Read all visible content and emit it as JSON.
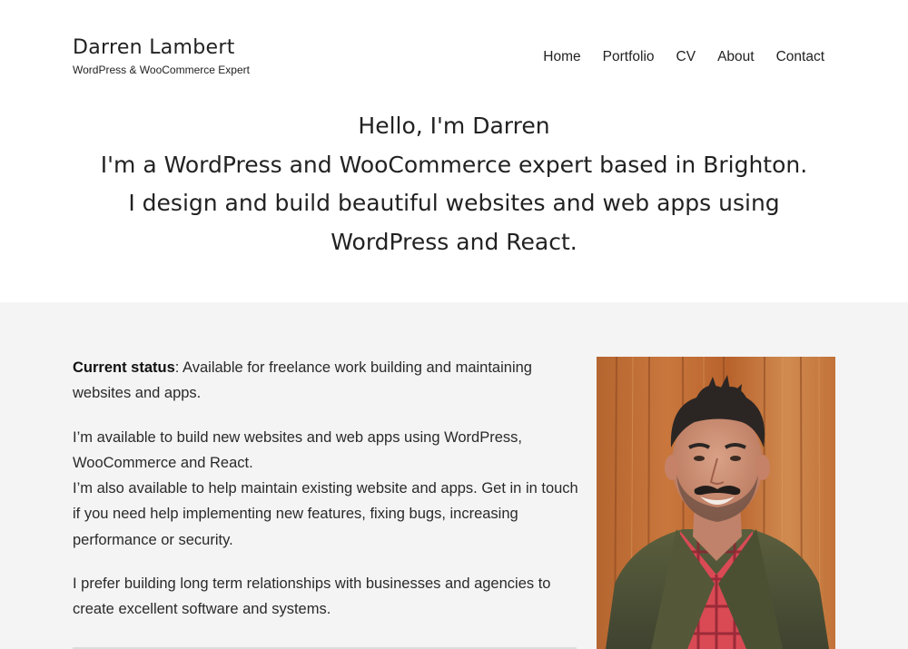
{
  "site": {
    "title": "Darren Lambert",
    "tagline": "WordPress & WooCommerce Expert"
  },
  "nav": {
    "items": [
      {
        "label": "Home"
      },
      {
        "label": "Portfolio"
      },
      {
        "label": "CV"
      },
      {
        "label": "About"
      },
      {
        "label": "Contact"
      }
    ]
  },
  "hero": {
    "lines": [
      "Hello, I'm Darren",
      "I'm a WordPress and WooCommerce expert based in Brighton.",
      "I design and build beautiful websites and web apps using",
      "WordPress and React."
    ]
  },
  "content": {
    "status_label": "Current status",
    "status_text": ": Available for freelance work building and maintaining websites and apps.",
    "para2_line1": "I’m available to build new websites and web apps using WordPress, WooCommerce and React.",
    "para2_line2": "I’m also available to help maintain existing website and apps. Get in in touch if you need help implementing new features, fixing bugs, increasing performance or security.",
    "para3": "I prefer building long term relationships with businesses and agencies to create excellent software and systems."
  }
}
